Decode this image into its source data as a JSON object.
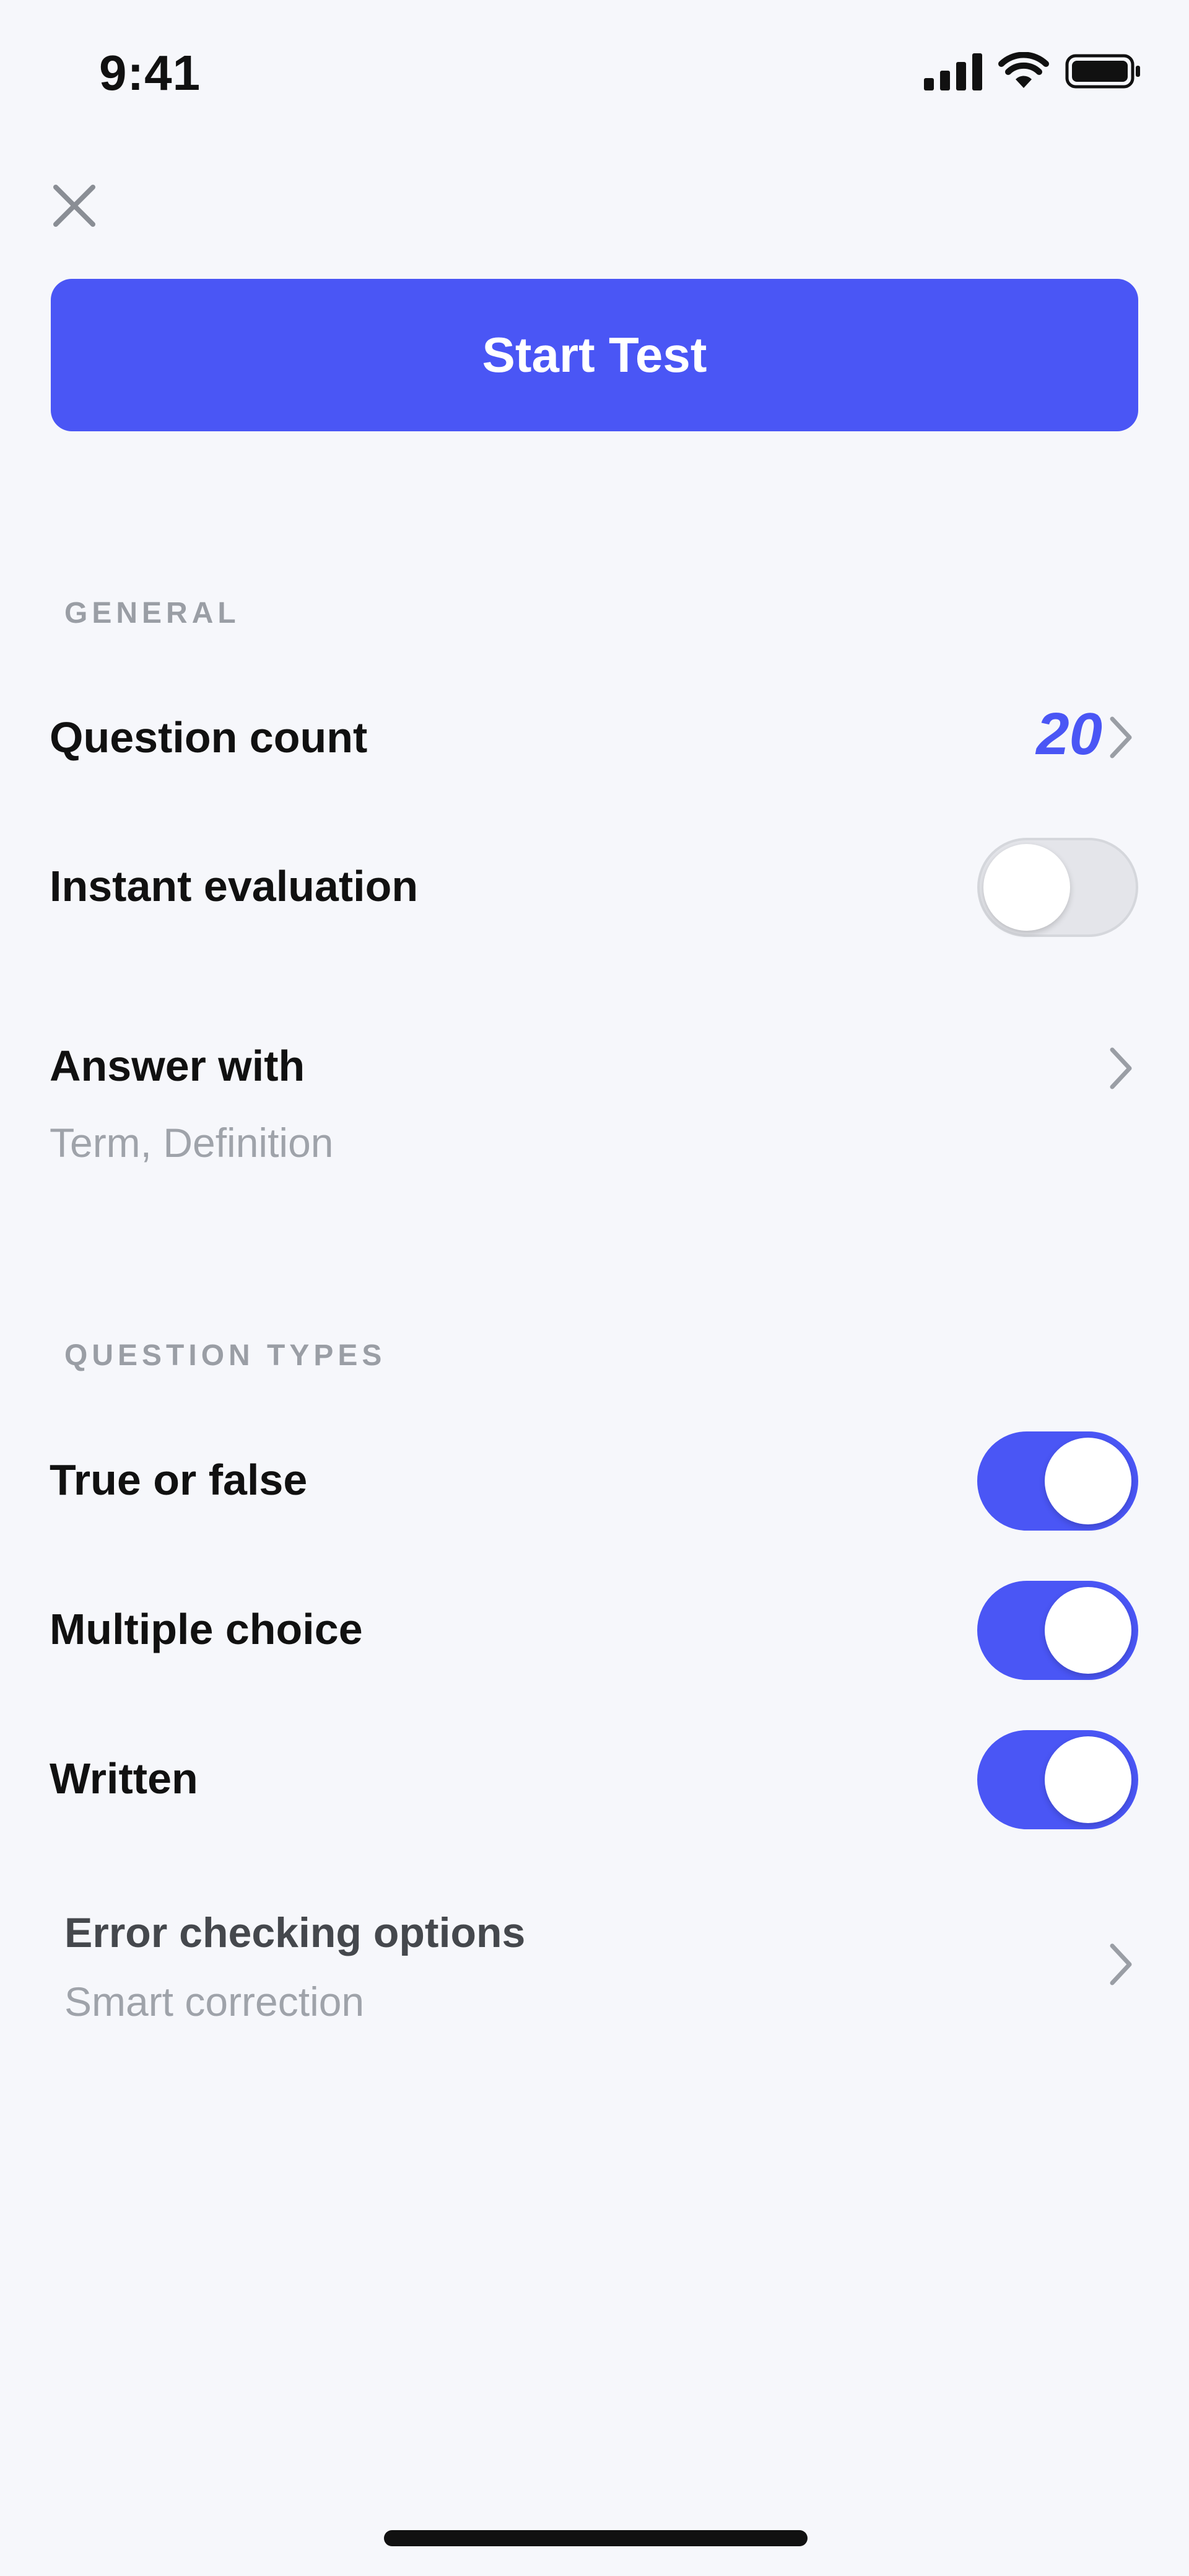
{
  "status_bar": {
    "time": "9:41"
  },
  "header": {
    "start_label": "Start Test"
  },
  "general": {
    "header": "GENERAL",
    "question_count": {
      "label": "Question count",
      "value": "20"
    },
    "instant_evaluation": {
      "label": "Instant evaluation",
      "enabled": false
    },
    "answer_with": {
      "label": "Answer with",
      "value": "Term, Definition"
    }
  },
  "question_types": {
    "header": "QUESTION TYPES",
    "true_false": {
      "label": "True or false",
      "enabled": true
    },
    "multiple_choice": {
      "label": "Multiple choice",
      "enabled": true
    },
    "written": {
      "label": "Written",
      "enabled": true
    },
    "error_checking": {
      "label": "Error checking options",
      "value": "Smart correction"
    }
  },
  "colors": {
    "accent": "#4a56f5",
    "background": "#f6f7fb",
    "text_primary": "#111111",
    "text_secondary": "#9fa3aa",
    "section_header": "#9a9ea5",
    "toggle_off": "#e4e5ea"
  },
  "icons": [
    "signal-icon",
    "wifi-icon",
    "battery-icon",
    "close-icon",
    "chevron-right-icon"
  ]
}
